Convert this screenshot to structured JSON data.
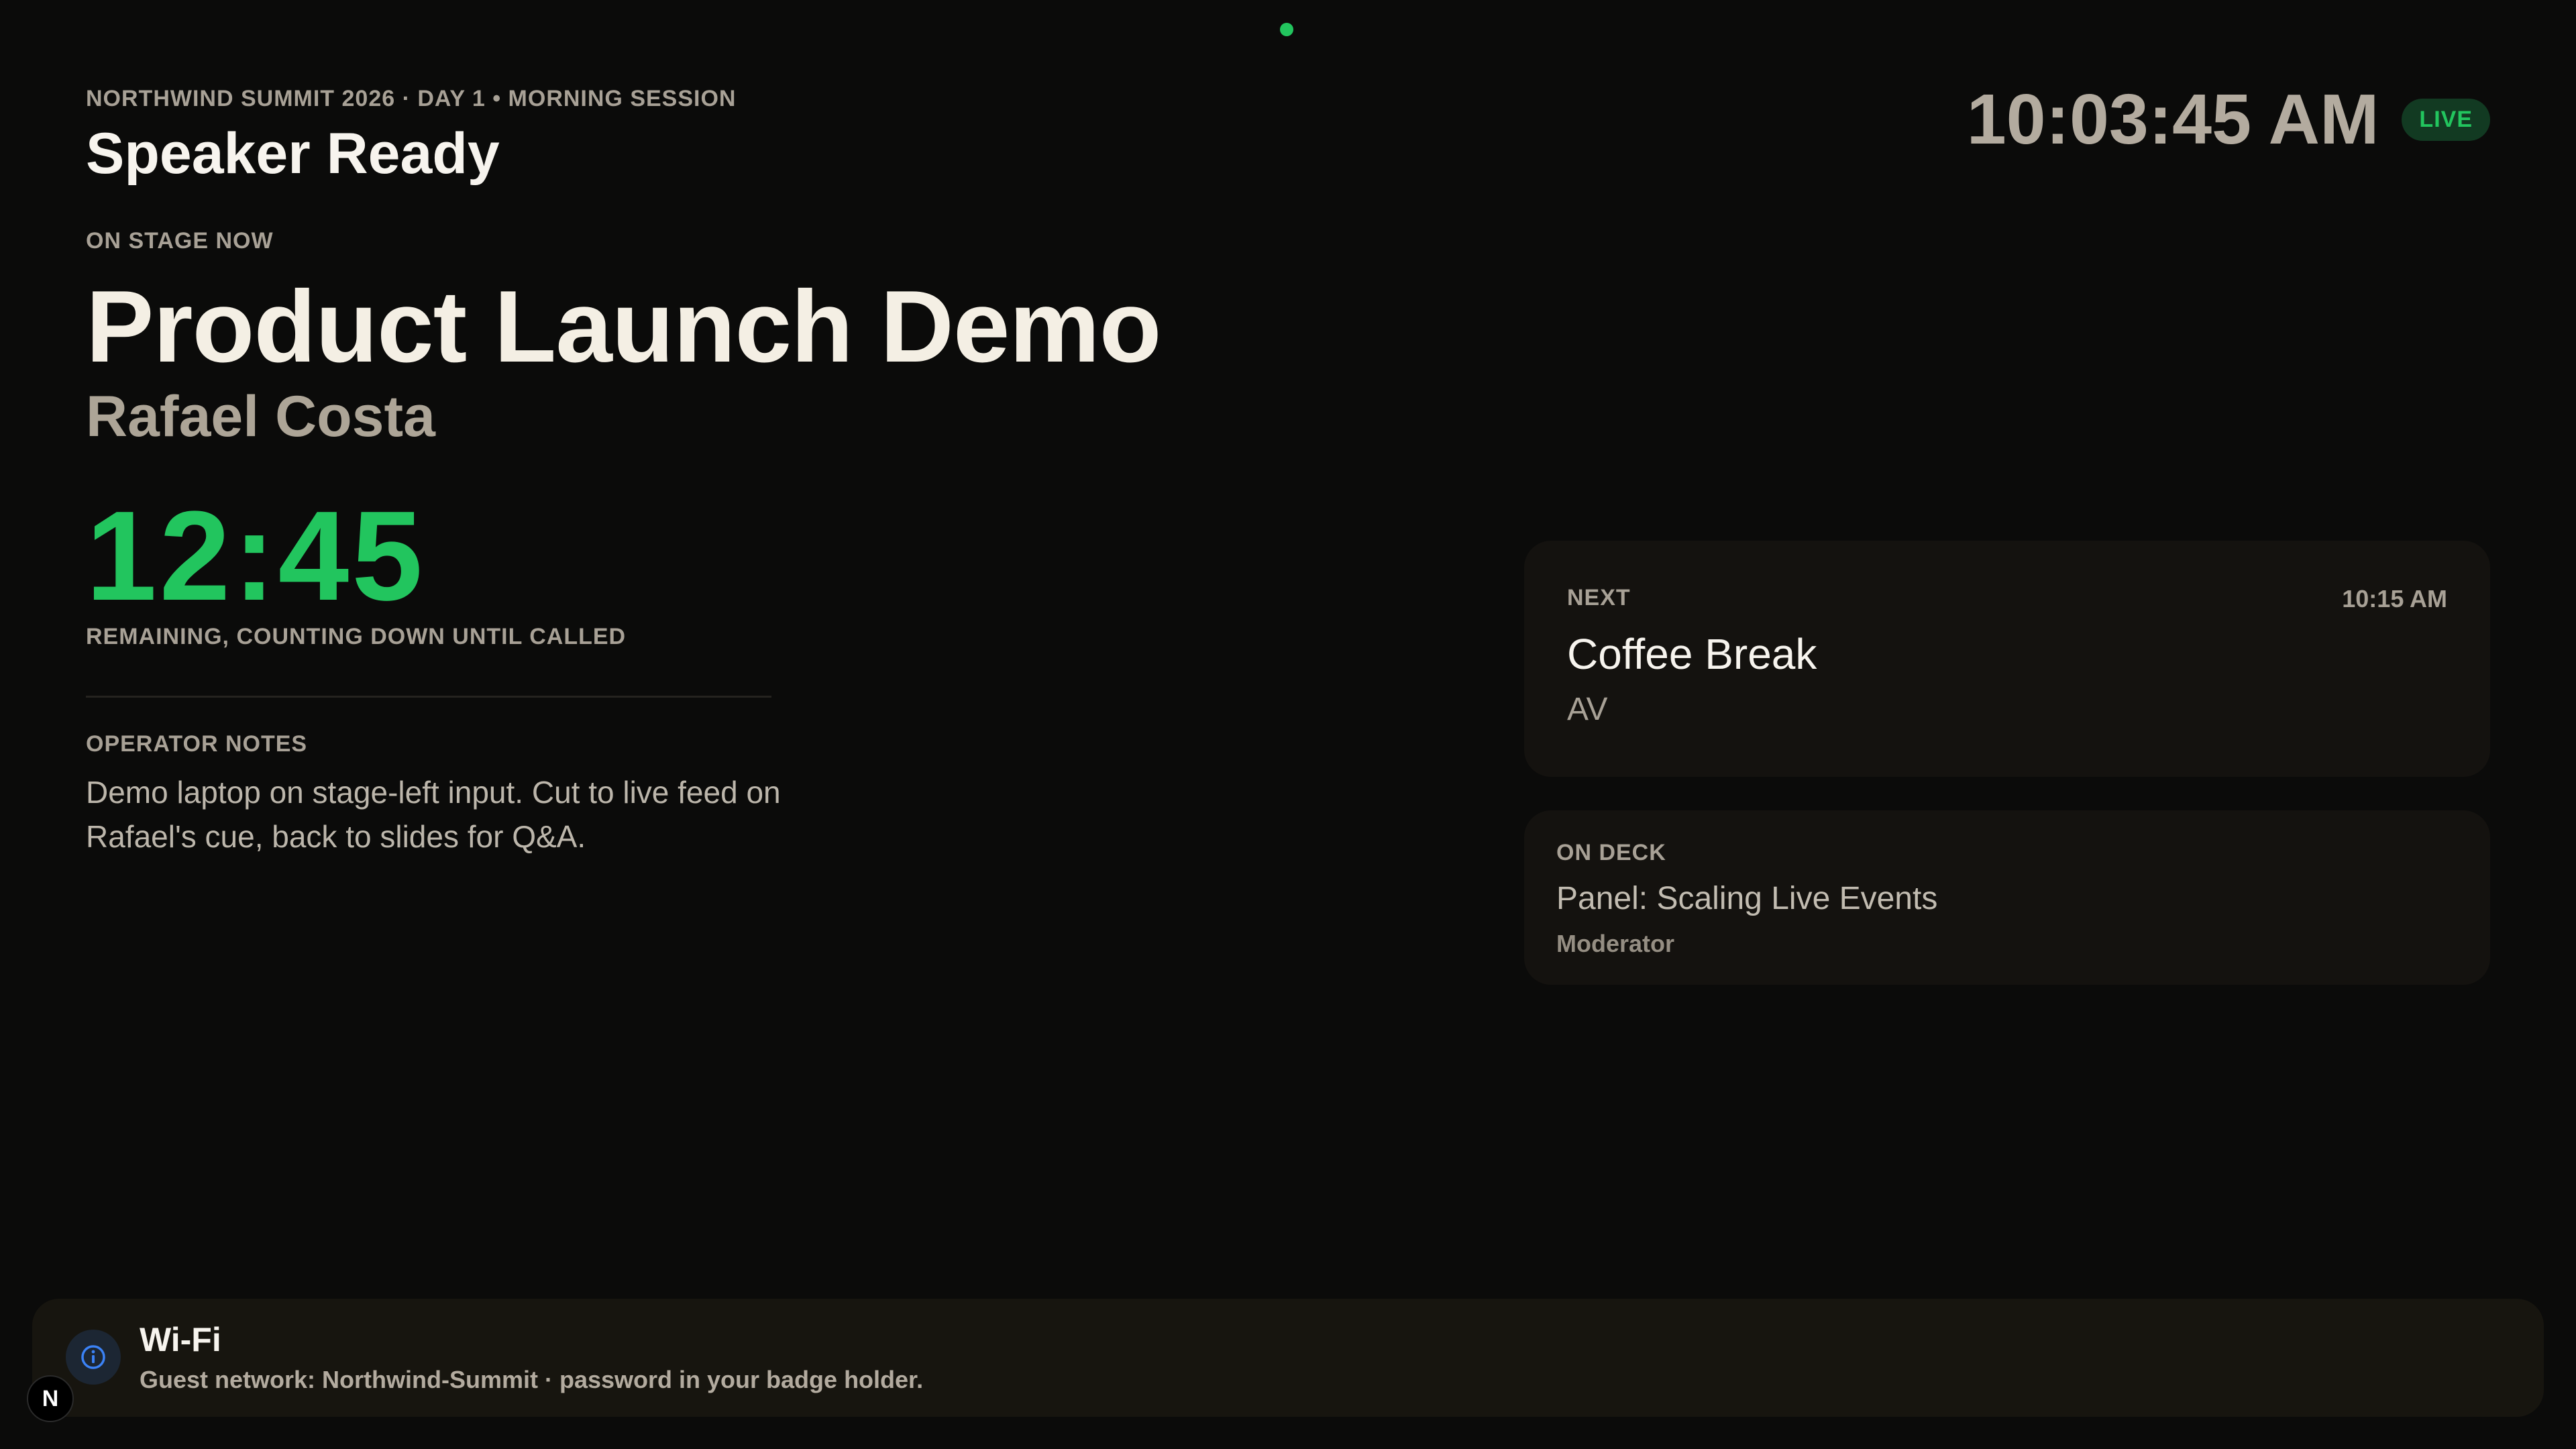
{
  "header": {
    "event_line": "NORTHWIND SUMMIT 2026 · DAY 1 • MORNING SESSION",
    "title": "Speaker Ready",
    "clock": "10:03:45 AM",
    "live_label": "LIVE"
  },
  "current": {
    "label": "ON STAGE NOW",
    "session_title": "Product Launch Demo",
    "speaker": "Rafael Costa",
    "countdown": "12:45",
    "countdown_caption": "REMAINING, COUNTING DOWN UNTIL CALLED"
  },
  "notes": {
    "label": "OPERATOR NOTES",
    "body": "Demo laptop on stage-left input. Cut to live feed on Rafael's cue, back to slides for Q&A."
  },
  "next": {
    "label": "NEXT",
    "time": "10:15 AM",
    "title": "Coffee Break",
    "subtitle": "AV"
  },
  "on_deck": {
    "label": "ON DECK",
    "title": "Panel: Scaling Live Events",
    "subtitle": "Moderator"
  },
  "toast": {
    "icon": "info-icon",
    "title": "Wi-Fi",
    "body": "Guest network: Northwind-Summit · password in your badge holder."
  },
  "brand_badge": {
    "icon": "n-logo-icon",
    "letter": "N"
  },
  "colors": {
    "background": "#0b0b0a",
    "accent_green": "#22c55e",
    "card": "#14120f",
    "info_blue": "#3b82f6"
  }
}
